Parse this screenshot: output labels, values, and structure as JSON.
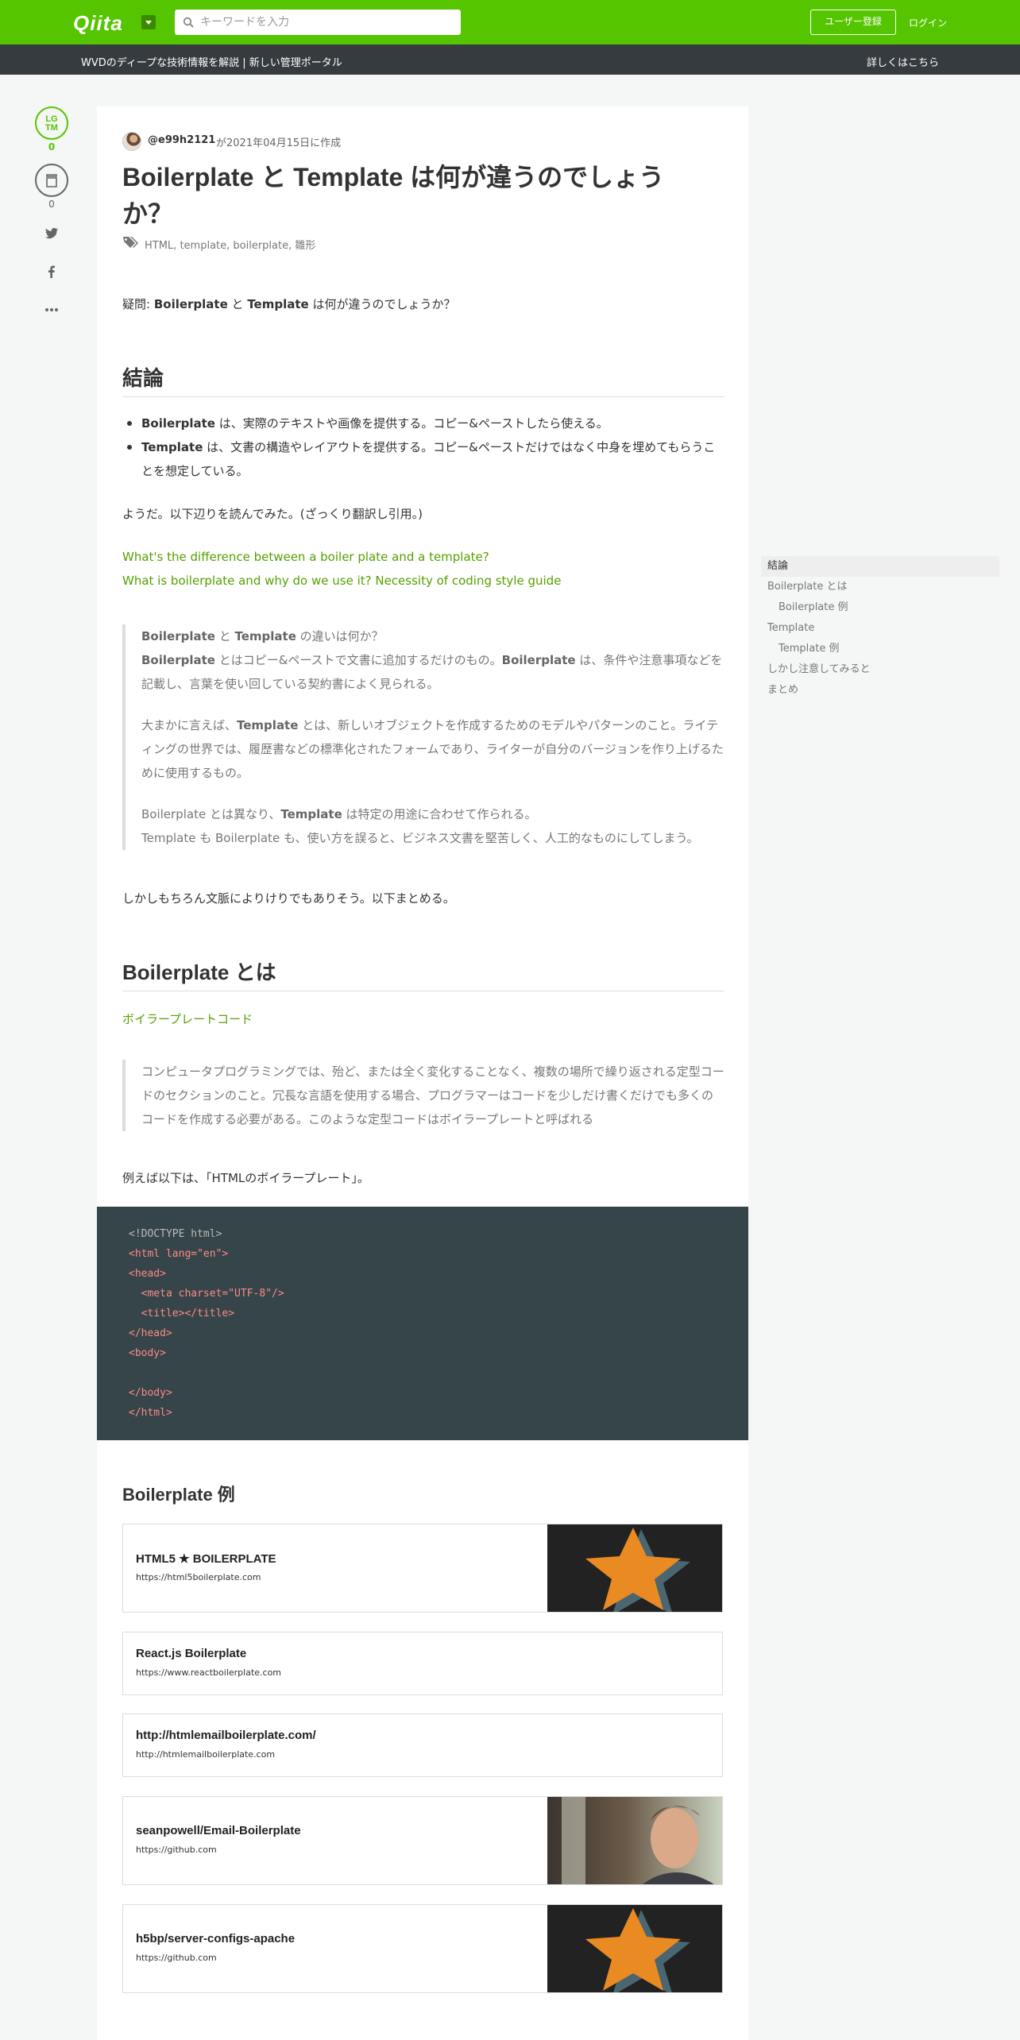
{
  "header": {
    "logo": "Qiita",
    "search_placeholder": "キーワードを入力",
    "signup_label": "ユーザー登録",
    "login_label": "ログイン",
    "brand_color": "#55c500"
  },
  "subbar": {
    "text": "WVDのディープな技術情報を解説 | 新しい管理ポータル",
    "link": "詳しくはこちら"
  },
  "actions": {
    "lgtm_line1": "LG",
    "lgtm_line2": "TM",
    "lgtm_count": "0",
    "stock_count": "0",
    "icons": [
      "lgtm-icon",
      "stock-icon",
      "twitter-icon",
      "facebook-icon",
      "more-icon"
    ]
  },
  "article": {
    "author": "@e99h2121",
    "created": "が2021年04月15日に作成",
    "title": "Boilerplate と Template は何が違うのでしょうか？",
    "tags": "HTML, template, boilerplate, 雛形",
    "question": {
      "prefix": "疑問: ",
      "b1": "Boilerplate",
      "mid": " と ",
      "b2": "Template",
      "suffix": " は何が違うのでしょうか？"
    },
    "h2_conclusion": "結論",
    "conclusion_items": [
      {
        "bold": "Boilerplate",
        "text": " は、実際のテキストや画像を提供する。コピー&ペーストしたら使える。"
      },
      {
        "bold": "Template",
        "text": " は、文書の構造やレイアウトを提供する。コピー&ペーストだけではなく中身を埋めてもらうことを想定している。"
      }
    ],
    "after_conclusion": "ようだ。以下辺りを読んでみた。(ざっくり翻訳し引用。)",
    "links": [
      "What's the difference between a boiler plate and a template?",
      "What is boilerplate and why do we use it? Necessity of coding style guide"
    ],
    "quote1": {
      "p1_b1": "Boilerplate",
      "p1_mid": " と ",
      "p1_b2": "Template",
      "p1_end": " の違いは何か？",
      "p2_b1": "Boilerplate",
      "p2_t1": " とはコピー&ペーストで文書に追加するだけのもの。",
      "p2_b2": "Boilerplate",
      "p2_t2": " は、条件や注意事項などを記載し、言葉を使い回している契約書によく見られる。",
      "p3_t1": "大まかに言えば、",
      "p3_b1": "Template",
      "p3_t2": " とは、新しいオブジェクトを作成するためのモデルやパターンのこと。ライティングの世界では、履歴書などの標準化されたフォームであり、ライターが自分のバージョンを作り上げるために使用するもの。",
      "p4_t1": "Boilerplate とは異なり、",
      "p4_b1": "Template",
      "p4_t2": " は特定の用途に合わせて作られる。",
      "p5": "Template も Boilerplate も、使い方を誤ると、ビジネス文書を堅苦しく、人工的なものにしてしまう。"
    },
    "after_quote": "しかしもちろん文脈によりけりでもありそう。以下まとめる。",
    "h2_boilerplate": "Boilerplate とは",
    "bp_link": "ボイラープレートコード",
    "quote2": "コンピュータプログラミングでは、殆ど、または全く変化することなく、複数の場所で繰り返される定型コードのセクションのこと。冗長な言語を使用する場合、プログラマーはコードを少しだけ書くだけでも多くのコードを作成する必要がある。このような定型コードはボイラープレートと呼ばれる",
    "example_intro": "例えば以下は、「HTMLのボイラープレート」。",
    "code_lines": [
      "<!DOCTYPE html>",
      "<html lang=\"en\">",
      "<head>",
      "  <meta charset=\"UTF-8\"/>",
      "  <title></title>",
      "</head>",
      "<body>",
      "",
      "</body>",
      "</html>"
    ],
    "h3_examples": "Boilerplate 例",
    "cards": [
      {
        "title": "HTML5 ★ BOILERPLATE",
        "url": "https://html5boilerplate.com",
        "thumb": "star"
      },
      {
        "title": "React.js Boilerplate",
        "url": "https://www.reactboilerplate.com",
        "thumb": ""
      },
      {
        "title": "http://htmlemailboilerplate.com/",
        "url": "http://htmlemailboilerplate.com",
        "thumb": ""
      },
      {
        "title": "seanpowell/Email-Boilerplate",
        "url": "https://github.com",
        "thumb": "photo"
      },
      {
        "title": "h5bp/server-configs-apache",
        "url": "https://github.com",
        "thumb": "star"
      }
    ]
  },
  "toc": [
    {
      "label": "結論",
      "level": 1,
      "active": true
    },
    {
      "label": "Boilerplate とは",
      "level": 1,
      "active": false
    },
    {
      "label": "Boilerplate 例",
      "level": 2,
      "active": false
    },
    {
      "label": "Template",
      "level": 1,
      "active": false
    },
    {
      "label": "Template 例",
      "level": 2,
      "active": false
    },
    {
      "label": "しかし注意してみると",
      "level": 1,
      "active": false
    },
    {
      "label": "まとめ",
      "level": 1,
      "active": false
    }
  ]
}
